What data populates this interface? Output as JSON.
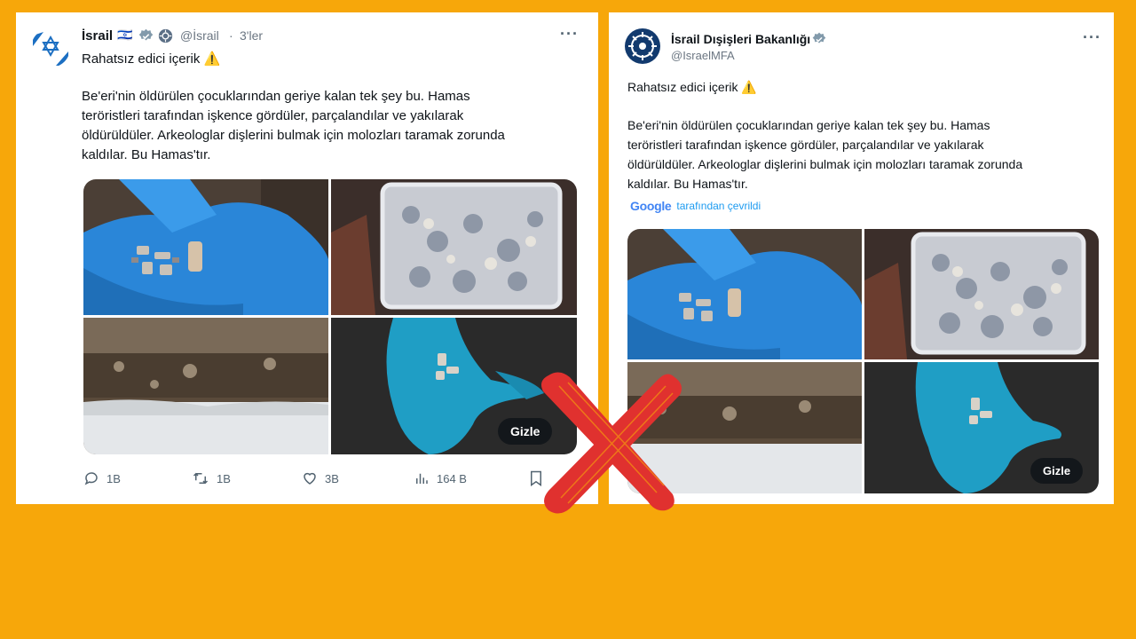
{
  "left_tweet": {
    "name": "İsrail",
    "flag": "🇮🇱",
    "handle": "@İsrail",
    "separator": "·",
    "time": "3'ler",
    "more": "···",
    "warning_label": "Rahatsız edici içerik",
    "warning_icon": "⚠️",
    "body_lines": [
      "Be'eri'nin öldürülen çocuklarından geriye kalan tek şey bu. Hamas",
      "teröristleri tarafından işkence gördüler, parçalandılar ve yakılarak",
      "öldürüldüler. Arkeologlar dişlerini bulmak için molozları taramak zorunda",
      "kaldılar. Bu Hamas'tır."
    ],
    "hide_label": "Gizle",
    "stats": {
      "replies": "1B",
      "retweets": "1B",
      "likes": "3B",
      "views": "164 B"
    }
  },
  "right_tweet": {
    "name": "İsrail Dışişleri Bakanlığı",
    "handle": "@IsraelMFA",
    "more": "···",
    "warning_label": "Rahatsız edici içerik",
    "warning_icon": "⚠️",
    "body_lines": [
      "Be'eri'nin öldürülen çocuklarından geriye kalan tek şey bu. Hamas",
      "teröristleri tarafından işkence gördüler, parçalandılar ve yakılarak",
      "öldürüldüler. Arkeologlar dişlerini bulmak için molozları taramak zorunda",
      "kaldılar. Bu Hamas'tır."
    ],
    "translation": {
      "brand": "Google",
      "label": "tarafından çevrildi"
    },
    "hide_label": "Gizle"
  },
  "colors": {
    "background": "#f7a70a",
    "verified": "#829aab",
    "link": "#1d9bf0",
    "cross": "#e0312f",
    "glove": "#2a8fe0",
    "glove_teal": "#1ea0c8"
  },
  "icons": [
    "verified-badge-icon",
    "flag-icon",
    "reply-icon",
    "retweet-icon",
    "like-icon",
    "views-icon",
    "bookmark-icon",
    "more-icon",
    "red-x-icon"
  ]
}
